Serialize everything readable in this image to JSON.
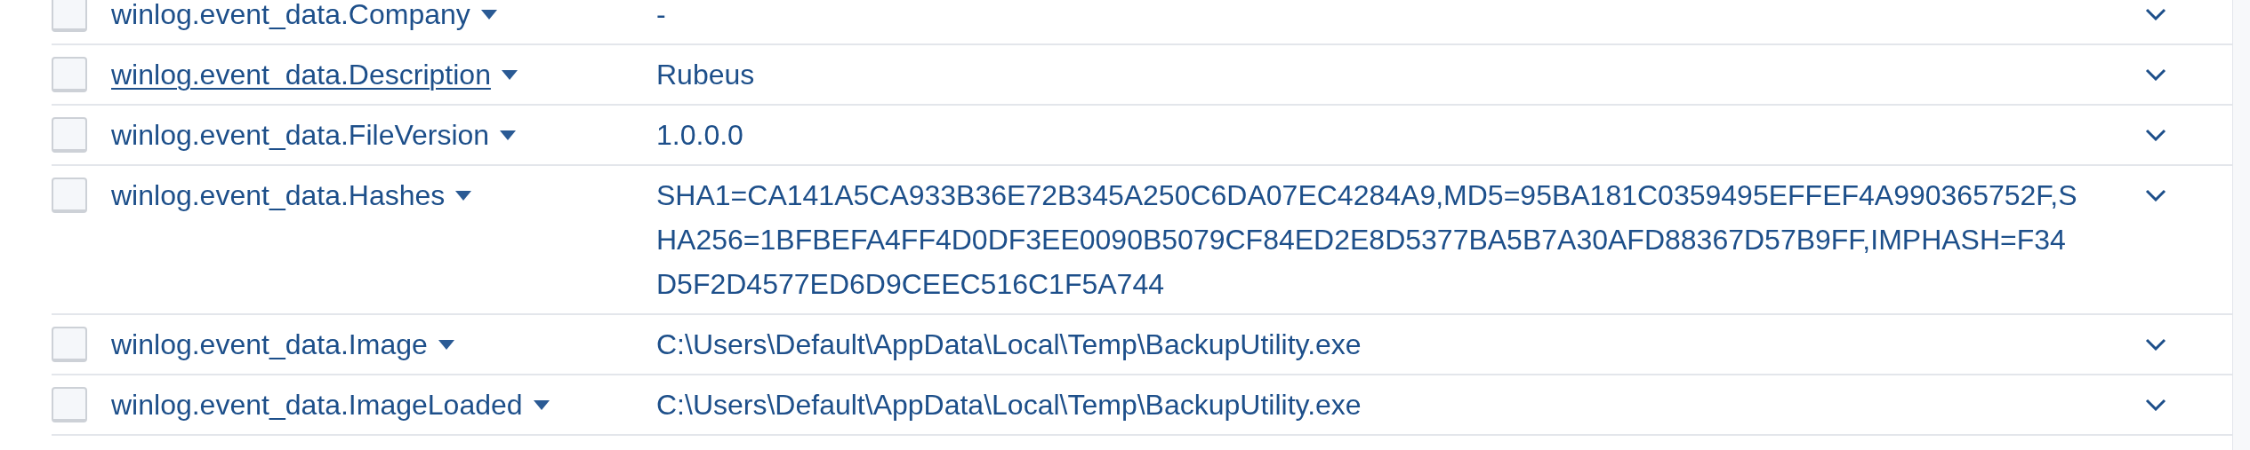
{
  "fields": [
    {
      "name": "winlog.event_data.Company",
      "value": "-",
      "checked": false,
      "hovered": false
    },
    {
      "name": "winlog.event_data.Description",
      "value": "Rubeus",
      "checked": false,
      "hovered": true
    },
    {
      "name": "winlog.event_data.FileVersion",
      "value": "1.0.0.0",
      "checked": false,
      "hovered": false
    },
    {
      "name": "winlog.event_data.Hashes",
      "value": "SHA1=CA141A5CA933B36E72B345A250C6DA07EC4284A9,MD5=95BA181C0359495EFFEF4A990365752F,SHA256=1BFBEFA4FF4D0DF3EE0090B5079CF84ED2E8D5377BA5B7A30AFD88367D57B9FF,IMPHASH=F34D5F2D4577ED6D9CEEC516C1F5A744",
      "checked": false,
      "hovered": false
    },
    {
      "name": "winlog.event_data.Image",
      "value": "C:\\Users\\Default\\AppData\\Local\\Temp\\BackupUtility.exe",
      "checked": false,
      "hovered": false
    },
    {
      "name": "winlog.event_data.ImageLoaded",
      "value": "C:\\Users\\Default\\AppData\\Local\\Temp\\BackupUtility.exe",
      "checked": false,
      "hovered": false
    }
  ]
}
